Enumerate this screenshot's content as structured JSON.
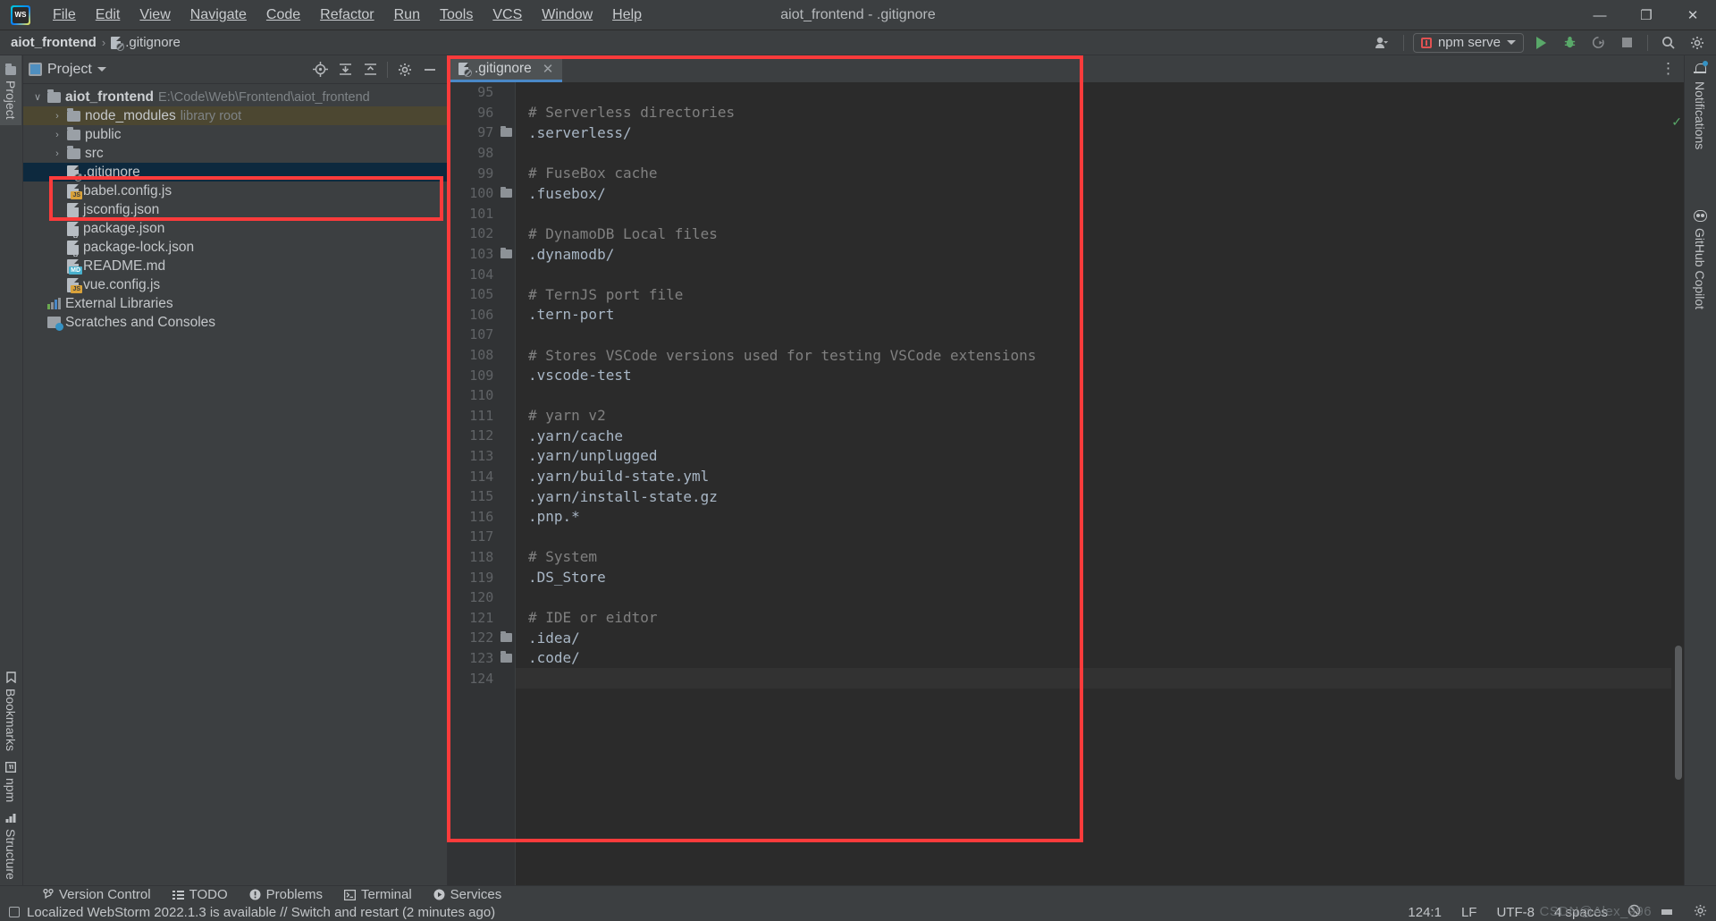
{
  "window": {
    "title": "aiot_frontend - .gitignore",
    "logo_text": "WS",
    "controls": {
      "minimize": "—",
      "maximize": "❐",
      "close": "✕"
    }
  },
  "menubar": [
    {
      "label": "File"
    },
    {
      "label": "Edit"
    },
    {
      "label": "View"
    },
    {
      "label": "Navigate"
    },
    {
      "label": "Code"
    },
    {
      "label": "Refactor"
    },
    {
      "label": "Run"
    },
    {
      "label": "Tools"
    },
    {
      "label": "VCS"
    },
    {
      "label": "Window"
    },
    {
      "label": "Help"
    }
  ],
  "breadcrumb": {
    "project": "aiot_frontend",
    "separator": "›",
    "file": ".gitignore"
  },
  "toolbar": {
    "account_label": "account-icon",
    "run_config": "npm serve",
    "run_label": "run-button",
    "debug_label": "debug-button",
    "coverage_label": "run-with-coverage-button",
    "stop_label": "stop-button",
    "search_label": "search-everywhere-button",
    "settings_label": "settings-button"
  },
  "left_strip": {
    "top": [
      {
        "label": "Project",
        "selected": true
      }
    ],
    "bottom": [
      {
        "label": "Bookmarks"
      },
      {
        "label": "npm"
      },
      {
        "label": "Structure"
      }
    ]
  },
  "project_panel": {
    "title": "Project",
    "actions": [
      "locate-icon",
      "expand-all-icon",
      "collapse-all-icon",
      "settings-icon",
      "hide-icon"
    ],
    "tree": [
      {
        "indent": 0,
        "arrow": "∨",
        "icon": "folder",
        "label": "aiot_frontend",
        "bold": true,
        "hint": "E:\\Code\\Web\\Frontend\\aiot_frontend",
        "state": "root"
      },
      {
        "indent": 1,
        "arrow": "›",
        "icon": "folder",
        "label": "node_modules",
        "hint": "library root",
        "state": "library"
      },
      {
        "indent": 1,
        "arrow": "›",
        "icon": "folder",
        "label": "public",
        "hint": "",
        "state": ""
      },
      {
        "indent": 1,
        "arrow": "›",
        "icon": "folder",
        "label": "src",
        "hint": "",
        "state": ""
      },
      {
        "indent": 1,
        "arrow": "",
        "icon": "gitignore",
        "label": ".gitignore",
        "hint": "",
        "state": "selected"
      },
      {
        "indent": 1,
        "arrow": "",
        "icon": "js",
        "label": "babel.config.js",
        "hint": "",
        "state": ""
      },
      {
        "indent": 1,
        "arrow": "",
        "icon": "json",
        "label": "jsconfig.json",
        "hint": "",
        "state": ""
      },
      {
        "indent": 1,
        "arrow": "",
        "icon": "json",
        "label": "package.json",
        "hint": "",
        "state": ""
      },
      {
        "indent": 1,
        "arrow": "",
        "icon": "json",
        "label": "package-lock.json",
        "hint": "",
        "state": ""
      },
      {
        "indent": 1,
        "arrow": "",
        "icon": "md",
        "label": "README.md",
        "hint": "",
        "state": ""
      },
      {
        "indent": 1,
        "arrow": "",
        "icon": "js",
        "label": "vue.config.js",
        "hint": "",
        "state": ""
      },
      {
        "indent": 0,
        "arrow": "",
        "icon": "libs",
        "label": "External Libraries",
        "hint": "",
        "state": ""
      },
      {
        "indent": 0,
        "arrow": "",
        "icon": "scratch",
        "label": "Scratches and Consoles",
        "hint": "",
        "state": ""
      }
    ]
  },
  "editor": {
    "tab": {
      "label": ".gitignore",
      "close": "✕"
    },
    "options_icon": "⋮",
    "lines": [
      {
        "num": "95",
        "text": "",
        "comment": false,
        "fold": false
      },
      {
        "num": "96",
        "text": "# Serverless directories",
        "comment": true,
        "fold": false
      },
      {
        "num": "97",
        "text": ".serverless/",
        "comment": false,
        "fold": true
      },
      {
        "num": "98",
        "text": "",
        "comment": false,
        "fold": false
      },
      {
        "num": "99",
        "text": "# FuseBox cache",
        "comment": true,
        "fold": false
      },
      {
        "num": "100",
        "text": ".fusebox/",
        "comment": false,
        "fold": true
      },
      {
        "num": "101",
        "text": "",
        "comment": false,
        "fold": false
      },
      {
        "num": "102",
        "text": "# DynamoDB Local files",
        "comment": true,
        "fold": false
      },
      {
        "num": "103",
        "text": ".dynamodb/",
        "comment": false,
        "fold": true
      },
      {
        "num": "104",
        "text": "",
        "comment": false,
        "fold": false
      },
      {
        "num": "105",
        "text": "# TernJS port file",
        "comment": true,
        "fold": false
      },
      {
        "num": "106",
        "text": ".tern-port",
        "comment": false,
        "fold": false
      },
      {
        "num": "107",
        "text": "",
        "comment": false,
        "fold": false
      },
      {
        "num": "108",
        "text": "# Stores VSCode versions used for testing VSCode extensions",
        "comment": true,
        "fold": false
      },
      {
        "num": "109",
        "text": ".vscode-test",
        "comment": false,
        "fold": false
      },
      {
        "num": "110",
        "text": "",
        "comment": false,
        "fold": false
      },
      {
        "num": "111",
        "text": "# yarn v2",
        "comment": true,
        "fold": false
      },
      {
        "num": "112",
        "text": ".yarn/cache",
        "comment": false,
        "fold": false
      },
      {
        "num": "113",
        "text": ".yarn/unplugged",
        "comment": false,
        "fold": false
      },
      {
        "num": "114",
        "text": ".yarn/build-state.yml",
        "comment": false,
        "fold": false
      },
      {
        "num": "115",
        "text": ".yarn/install-state.gz",
        "comment": false,
        "fold": false
      },
      {
        "num": "116",
        "text": ".pnp.*",
        "comment": false,
        "fold": false
      },
      {
        "num": "117",
        "text": "",
        "comment": false,
        "fold": false
      },
      {
        "num": "118",
        "text": "# System",
        "comment": true,
        "fold": false
      },
      {
        "num": "119",
        "text": ".DS_Store",
        "comment": false,
        "fold": false
      },
      {
        "num": "120",
        "text": "",
        "comment": false,
        "fold": false
      },
      {
        "num": "121",
        "text": "# IDE or eidtor",
        "comment": true,
        "fold": false
      },
      {
        "num": "122",
        "text": ".idea/",
        "comment": false,
        "fold": true
      },
      {
        "num": "123",
        "text": ".code/",
        "comment": false,
        "fold": true
      },
      {
        "num": "124",
        "text": "",
        "comment": false,
        "fold": false,
        "current": true
      }
    ]
  },
  "right_strip": [
    {
      "label": "Notifications",
      "icon": "bell-icon",
      "badge": true
    },
    {
      "label": "GitHub Copilot",
      "icon": "copilot-icon",
      "badge": false
    }
  ],
  "bottom_tabs": [
    {
      "label": "Version Control",
      "icon": "branch-icon"
    },
    {
      "label": "TODO",
      "icon": "list-icon"
    },
    {
      "label": "Problems",
      "icon": "warning-icon"
    },
    {
      "label": "Terminal",
      "icon": "terminal-icon"
    },
    {
      "label": "Services",
      "icon": "play-circle-icon"
    }
  ],
  "status": {
    "message": "Localized WebStorm 2022.1.3 is available // Switch and restart (2 minutes ago)",
    "caret": "124:1",
    "line_sep": "LF",
    "encoding": "UTF-8",
    "indent": "4 spaces"
  },
  "watermark": "CSDN@Alex_996",
  "colors": {
    "accent": "#4a88c7",
    "selection": "#0d293e",
    "library": "#4c4731",
    "annotation": "#fb3b3b",
    "editor_bg": "#2b2b2b",
    "panel_bg": "#3c3f41"
  }
}
